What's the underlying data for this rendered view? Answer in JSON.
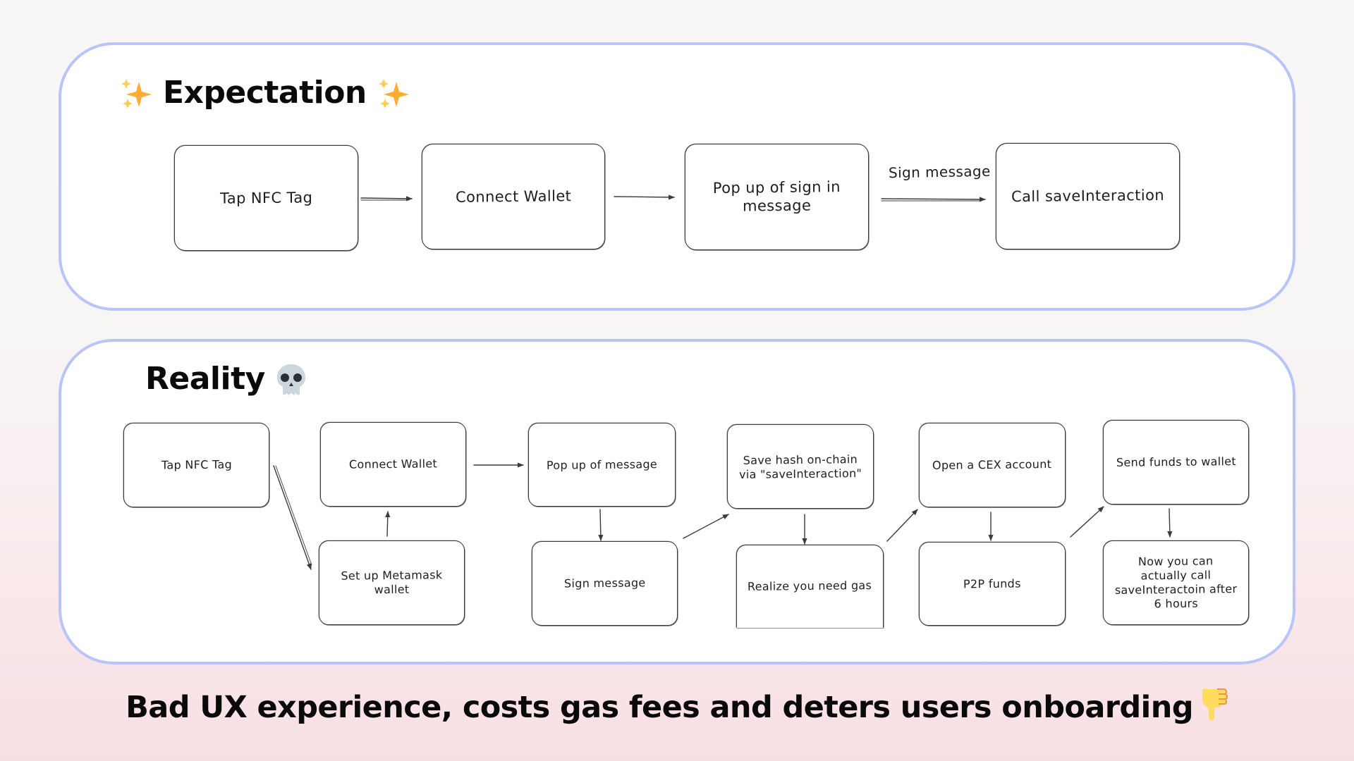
{
  "expectation": {
    "title": "Expectation",
    "title_icons": [
      "sparkles-icon",
      "sparkles-icon"
    ],
    "nodes": [
      {
        "id": "e1",
        "label": "Tap NFC Tag"
      },
      {
        "id": "e2",
        "label": "Connect Wallet"
      },
      {
        "id": "e3",
        "label": "Pop up of sign in message"
      },
      {
        "id": "e4",
        "label": "Call saveInteraction"
      }
    ],
    "edges": [
      {
        "from": "e1",
        "to": "e2",
        "label": ""
      },
      {
        "from": "e2",
        "to": "e3",
        "label": ""
      },
      {
        "from": "e3",
        "to": "e4",
        "label": "Sign message"
      }
    ]
  },
  "reality": {
    "title": "Reality",
    "title_icon": "skull-icon",
    "nodes": [
      {
        "id": "r1",
        "label": "Tap NFC Tag"
      },
      {
        "id": "r2",
        "label": "Set up Metamask wallet"
      },
      {
        "id": "r3",
        "label": "Connect Wallet"
      },
      {
        "id": "r4",
        "label": "Pop up of message"
      },
      {
        "id": "r5",
        "label": "Sign message"
      },
      {
        "id": "r6",
        "label": "Save hash on-chain via \"saveInteraction\""
      },
      {
        "id": "r7",
        "label": "Realize you need gas"
      },
      {
        "id": "r8",
        "label": "Open a CEX account"
      },
      {
        "id": "r9",
        "label": "P2P funds"
      },
      {
        "id": "r10",
        "label": "Send funds to wallet"
      },
      {
        "id": "r11",
        "label": "Now you can actually call saveInteractoin after 6 hours"
      }
    ],
    "edges": [
      {
        "from": "r1",
        "to": "r2"
      },
      {
        "from": "r2",
        "to": "r3"
      },
      {
        "from": "r3",
        "to": "r4"
      },
      {
        "from": "r4",
        "to": "r5"
      },
      {
        "from": "r5",
        "to": "r6"
      },
      {
        "from": "r6",
        "to": "r7"
      },
      {
        "from": "r7",
        "to": "r8"
      },
      {
        "from": "r8",
        "to": "r9"
      },
      {
        "from": "r9",
        "to": "r10"
      },
      {
        "from": "r10",
        "to": "r11"
      }
    ]
  },
  "caption": {
    "text": "Bad UX experience, costs gas fees and deters users onboarding",
    "icon": "thumbs-down-icon"
  },
  "colors": {
    "panel_border": "#b9c4f9",
    "sparkle": "#ffac33",
    "sparkle_small": "#ffcc4d",
    "skull": "#ccd6dd",
    "thumb": "#ffdc5d",
    "thumb_detail": "#ef9645",
    "stroke": "#3b3b3f"
  }
}
